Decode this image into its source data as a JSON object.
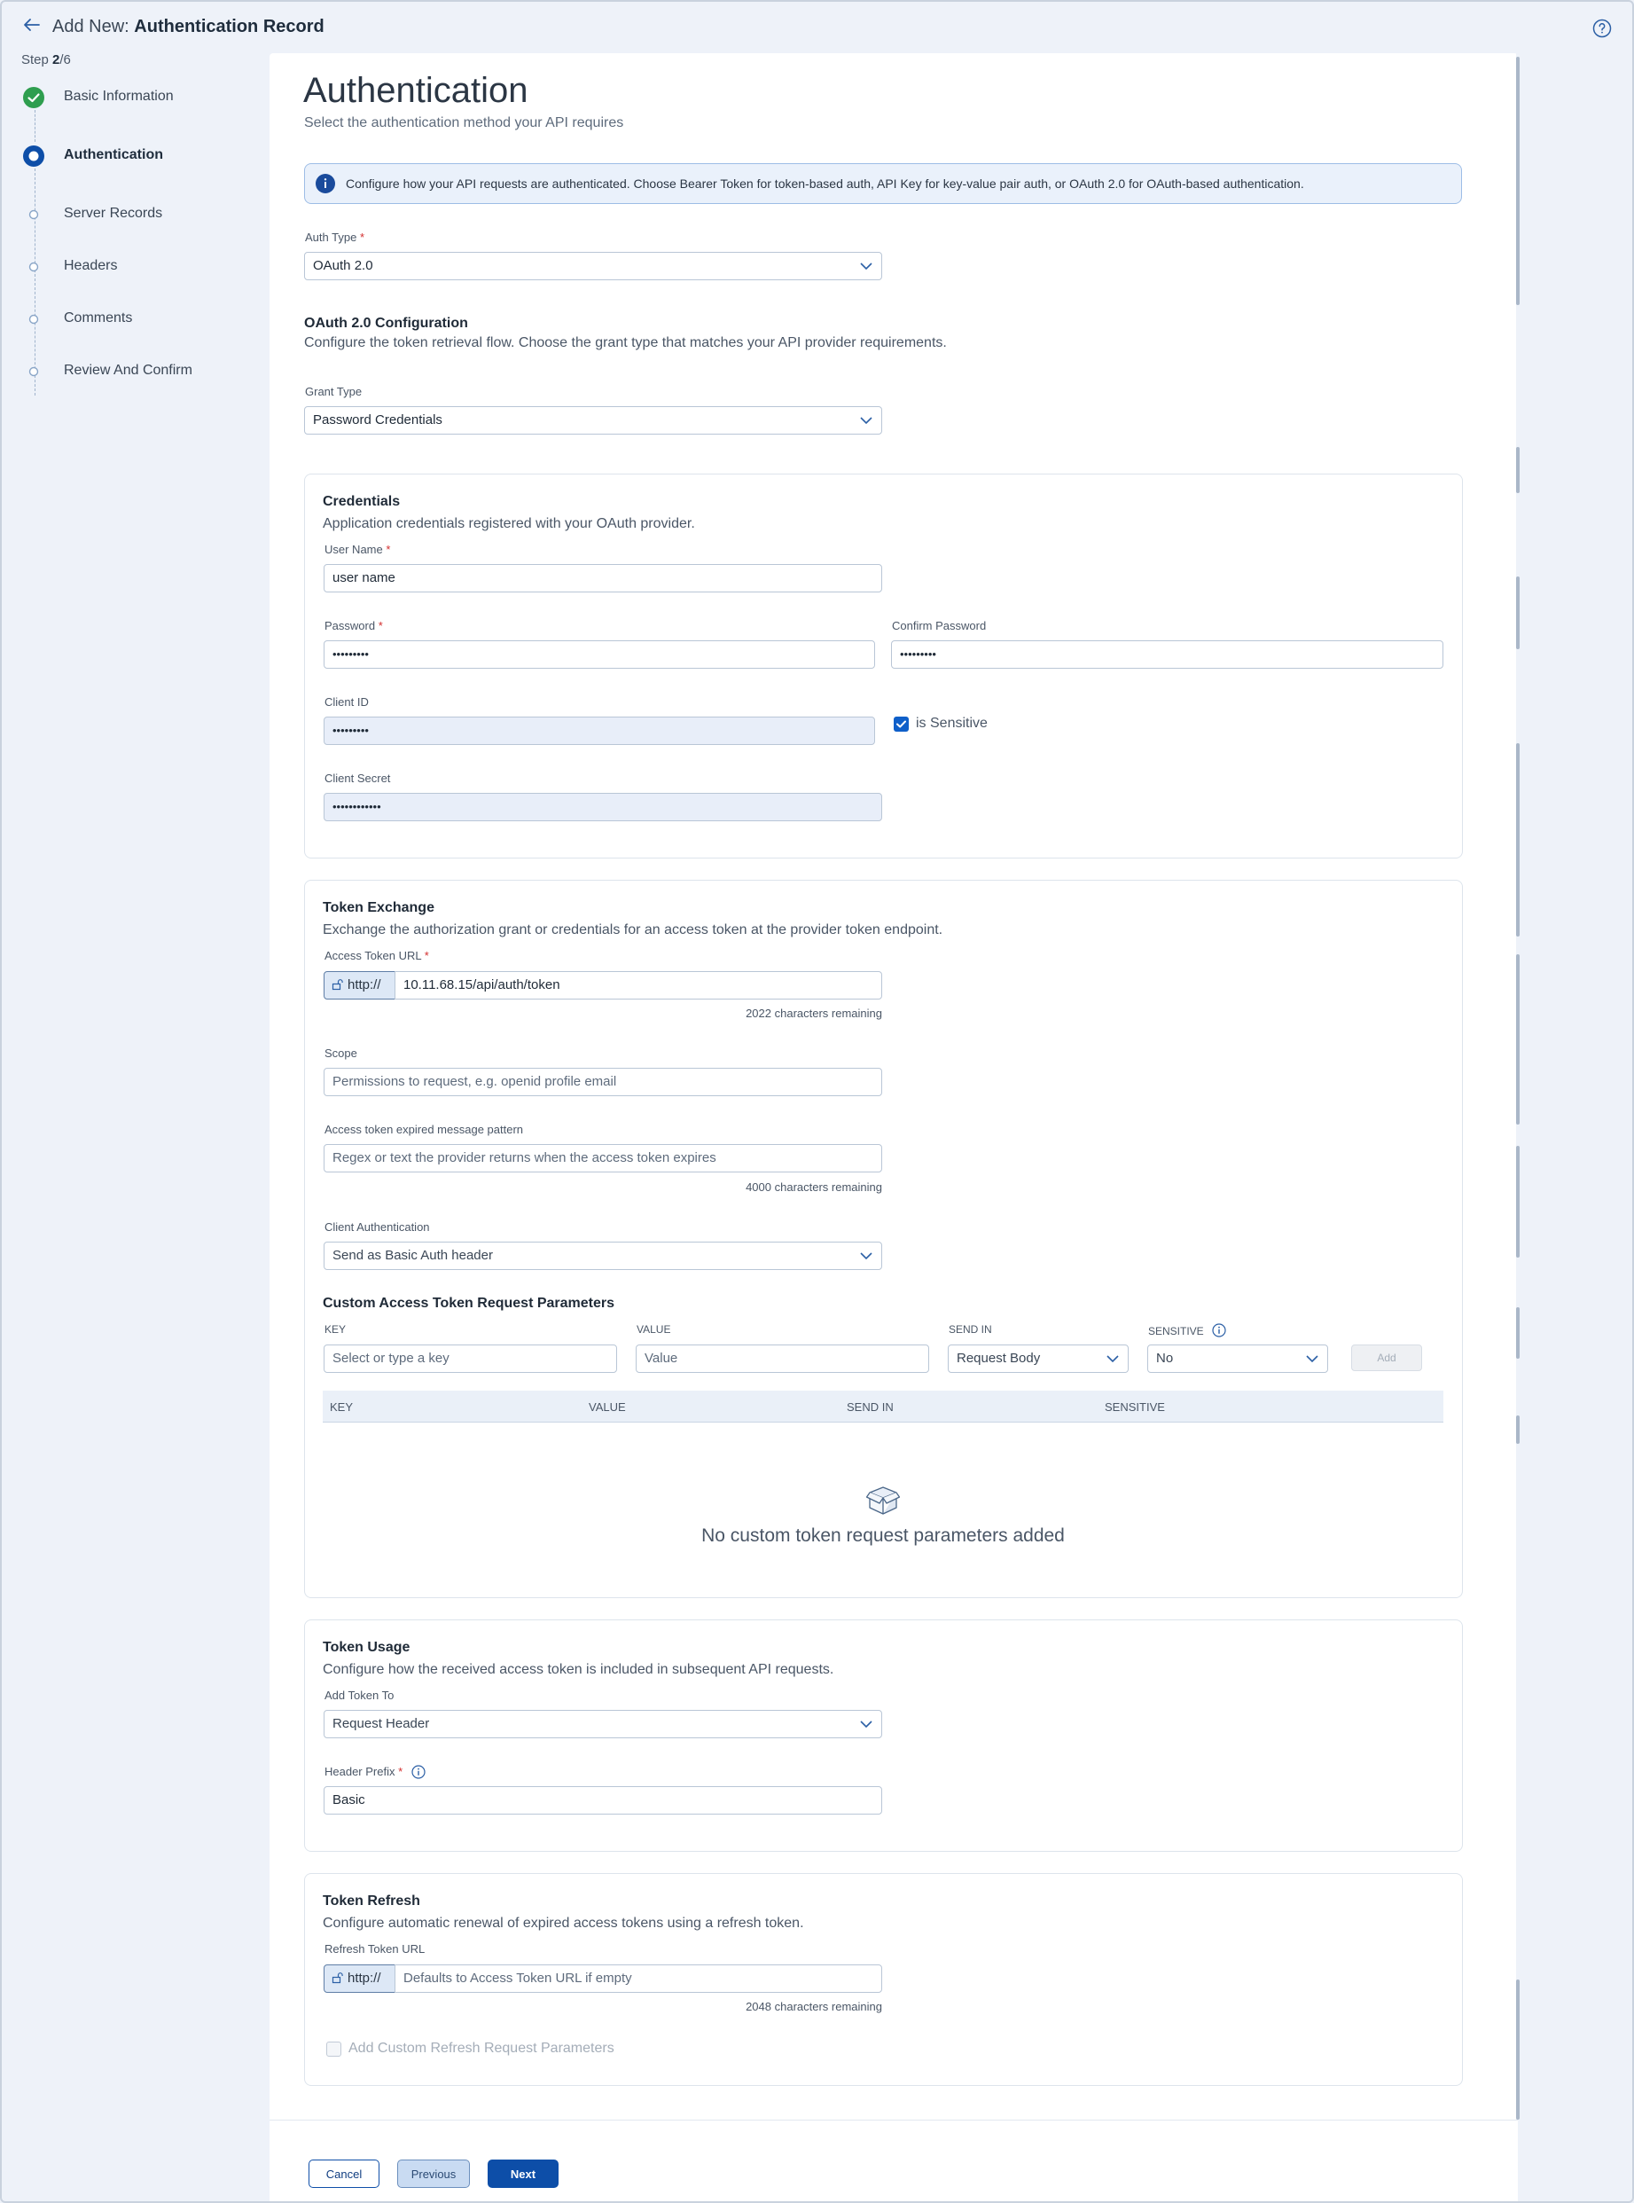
{
  "header": {
    "title_prefix": "Add New:",
    "title_bold": "Authentication Record"
  },
  "stepper": {
    "step_word": "Step",
    "current": "2",
    "total": "/6",
    "steps": [
      {
        "label": "Basic Information",
        "state": "done"
      },
      {
        "label": "Authentication",
        "state": "active"
      },
      {
        "label": "Server Records",
        "state": "pending"
      },
      {
        "label": "Headers",
        "state": "pending"
      },
      {
        "label": "Comments",
        "state": "pending"
      },
      {
        "label": "Review And Confirm",
        "state": "pending"
      }
    ]
  },
  "page": {
    "title": "Authentication",
    "subtitle": "Select the authentication method your API requires",
    "info": "Configure how your API requests are authenticated. Choose Bearer Token for token-based auth, API Key for key-value pair auth, or OAuth 2.0 for OAuth-based authentication."
  },
  "auth_type": {
    "label": "Auth Type",
    "required": "*",
    "value": "OAuth 2.0"
  },
  "oauth": {
    "title": "OAuth 2.0 Configuration",
    "subtitle": "Configure the token retrieval flow. Choose the grant type that matches your API provider requirements.",
    "grant_label": "Grant Type",
    "grant_value": "Password Credentials"
  },
  "credentials": {
    "title": "Credentials",
    "subtitle": "Application credentials registered with your OAuth provider.",
    "username_label": "User Name",
    "username_value": "user name",
    "password_label": "Password",
    "password_value": "•••••••••",
    "confirm_label": "Confirm Password",
    "confirm_value": "•••••••••",
    "client_id_label": "Client ID",
    "client_id_value": "•••••••••",
    "sensitive_label": "is Sensitive",
    "client_secret_label": "Client Secret",
    "client_secret_value": "••••••••••••",
    "required": "*"
  },
  "token_exchange": {
    "title": "Token Exchange",
    "subtitle": "Exchange the authorization grant or credentials for an access token at the provider token endpoint.",
    "url_label": "Access Token URL",
    "required": "*",
    "protocol": "http://",
    "url_value": "10.11.68.15/api/auth/token",
    "url_remaining": "2022 characters remaining",
    "scope_label": "Scope",
    "scope_placeholder": "Permissions to request, e.g. openid profile email",
    "expired_label": "Access token expired message pattern",
    "expired_placeholder": "Regex or text the provider returns when the access token expires",
    "expired_remaining": "4000 characters remaining",
    "client_auth_label": "Client Authentication",
    "client_auth_value": "Send as Basic Auth header",
    "params_title": "Custom Access Token Request Parameters",
    "col_key": "KEY",
    "col_value": "VALUE",
    "col_send_in": "SEND IN",
    "col_sensitive": "SENSITIVE",
    "key_placeholder": "Select or type a key",
    "value_placeholder": "Value",
    "send_in_value": "Request Body",
    "sensitive_value": "No",
    "add_label": "Add",
    "empty_message": "No custom token request parameters added"
  },
  "token_usage": {
    "title": "Token Usage",
    "subtitle": "Configure how the received access token is included in subsequent API requests.",
    "add_to_label": "Add Token To",
    "add_to_value": "Request Header",
    "prefix_label": "Header Prefix",
    "required": "*",
    "prefix_value": "Basic"
  },
  "token_refresh": {
    "title": "Token Refresh",
    "subtitle": "Configure automatic renewal of expired access tokens using a refresh token.",
    "url_label": "Refresh Token URL",
    "protocol": "http://",
    "url_placeholder": "Defaults to Access Token URL if empty",
    "remaining": "2048 characters remaining",
    "custom_params_label": "Add Custom Refresh Request Parameters"
  },
  "footer": {
    "cancel": "Cancel",
    "previous": "Previous",
    "next": "Next"
  },
  "colors": {
    "primary": "#0d4ea8",
    "success": "#2e9e4f",
    "required": "#d32f2f"
  }
}
